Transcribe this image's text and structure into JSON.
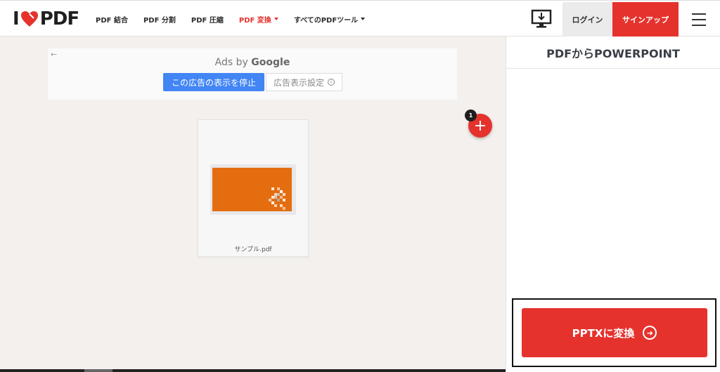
{
  "brand": {
    "logo_left": "I",
    "logo_right": "PDF",
    "accent_color": "#e5322d"
  },
  "nav": {
    "items": [
      {
        "label": "PDF 結合",
        "active": false
      },
      {
        "label": "PDF 分割",
        "active": false
      },
      {
        "label": "PDF 圧縮",
        "active": false
      },
      {
        "label": "PDF 変換",
        "active": true
      },
      {
        "label": "すべてのPDFツール",
        "active": false
      }
    ]
  },
  "header": {
    "download_icon": "desktop-download-icon",
    "login_label": "ログイン",
    "signup_label": "サインアップ",
    "menu_icon": "hamburger-menu-icon"
  },
  "ad": {
    "back_icon": "←",
    "ads_by_prefix": "Ads by ",
    "ads_by_brand": "Google",
    "stop_label": "この広告の表示を停止",
    "settings_label": "広告表示設定",
    "info_icon": "i"
  },
  "workspace": {
    "add_icon": "+",
    "file_count": "1",
    "files": [
      {
        "name": "サンプル.pdf",
        "thumbnail_color": "#e46d10"
      }
    ]
  },
  "panel": {
    "title": "PDFからPOWERPOINT",
    "convert_label": "PPTXに変換",
    "convert_icon": "arrow-right-circle-icon"
  }
}
